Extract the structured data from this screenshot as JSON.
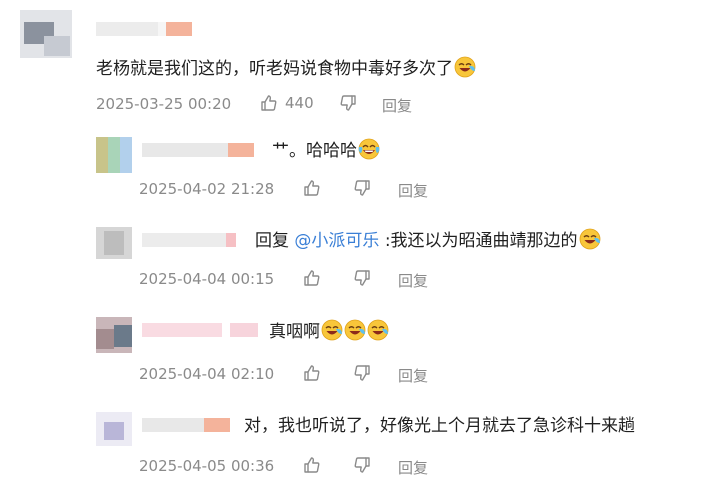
{
  "comments": [
    {
      "text": "老杨就是我们这的，听老妈说食物中毒好多次了",
      "date": "2025-03-25 00:20",
      "likes": "440",
      "reply_label": "回复",
      "emoji": [
        "crying-laugh-emoji"
      ]
    },
    {
      "text": "艹。哈哈哈",
      "date": "2025-04-02 21:28",
      "reply_label": "回复",
      "emoji": [
        "tears-of-joy-emoji"
      ]
    },
    {
      "reply_prefix": "回复",
      "mention": "@小派可乐",
      "text": ":我还以为昭通曲靖那边的",
      "date": "2025-04-04 00:15",
      "reply_label": "回复",
      "emoji": [
        "crying-laugh-emoji"
      ]
    },
    {
      "text": "真咽啊",
      "date": "2025-04-04 02:10",
      "reply_label": "回复",
      "emoji": [
        "crying-laugh-emoji",
        "crying-laugh-emoji",
        "crying-laugh-emoji"
      ]
    },
    {
      "text": "对，我也听说了，好像光上个月就去了急诊科十来趟",
      "date": "2025-04-05 00:36",
      "reply_label": "回复",
      "emoji": []
    }
  ],
  "colors": {
    "meta": "#8a8a8a",
    "mention": "#3a7fd6",
    "emoji_face": "#f8c63a"
  }
}
